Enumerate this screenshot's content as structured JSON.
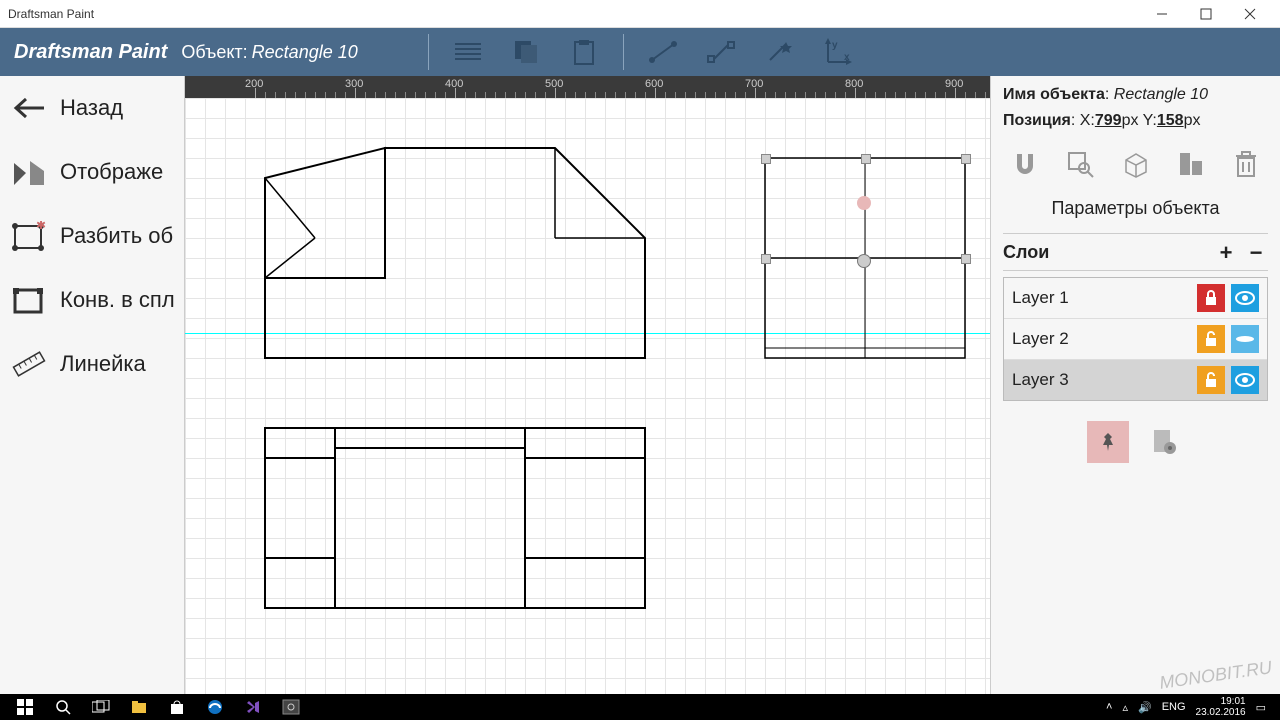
{
  "window": {
    "title": "Draftsman Paint"
  },
  "toolbar": {
    "brand": "Draftsman Paint",
    "object_prefix": "Объект:",
    "object_name": "Rectangle 10"
  },
  "left": {
    "back": "Назад",
    "display": "Отображе",
    "break": "Разбить об",
    "spline": "Конв. в спл",
    "ruler": "Линейка"
  },
  "right": {
    "name_label": "Имя объекта",
    "name_value": "Rectangle 10",
    "pos_label": "Позиция",
    "x_label": "X:",
    "x_value": "799",
    "y_label": "Y:",
    "y_value": "158",
    "px": "px",
    "params_title": "Параметры объекта",
    "layers_title": "Слои"
  },
  "layers": [
    {
      "name": "Layer 1",
      "locked": true,
      "visible": true,
      "lockColor": "red"
    },
    {
      "name": "Layer 2",
      "locked": false,
      "visible": true,
      "lockColor": "yellow",
      "eyeAlt": true
    },
    {
      "name": "Layer 3",
      "locked": false,
      "visible": true,
      "lockColor": "yellow",
      "selected": true
    }
  ],
  "ruler_ticks": [
    "200",
    "300",
    "400",
    "500",
    "600",
    "700",
    "800",
    "900"
  ],
  "taskbar": {
    "lang": "ENG",
    "time": "19:01",
    "date": "23.02.2016"
  },
  "watermark": "MONOBIT.RU"
}
